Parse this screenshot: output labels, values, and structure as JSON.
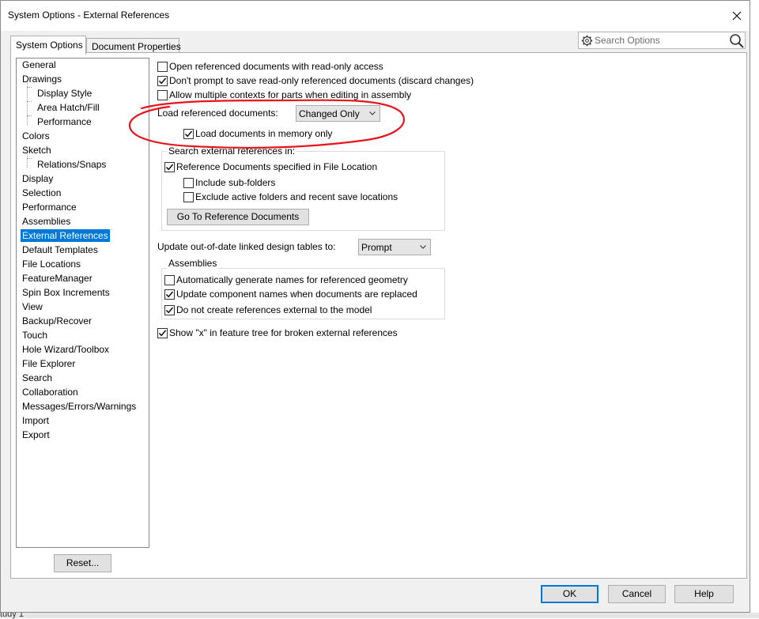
{
  "window": {
    "title": "System Options - External References"
  },
  "tabs": [
    {
      "label": "System Options"
    },
    {
      "label": "Document Properties"
    }
  ],
  "search": {
    "placeholder": "Search Options"
  },
  "tree": {
    "items": [
      {
        "label": "General"
      },
      {
        "label": "Drawings"
      },
      {
        "label": "Display Style"
      },
      {
        "label": "Area Hatch/Fill"
      },
      {
        "label": "Performance"
      },
      {
        "label": "Colors"
      },
      {
        "label": "Sketch"
      },
      {
        "label": "Relations/Snaps"
      },
      {
        "label": "Display"
      },
      {
        "label": "Selection"
      },
      {
        "label": "Performance"
      },
      {
        "label": "Assemblies"
      },
      {
        "label": "External References"
      },
      {
        "label": "Default Templates"
      },
      {
        "label": "File Locations"
      },
      {
        "label": "FeatureManager"
      },
      {
        "label": "Spin Box Increments"
      },
      {
        "label": "View"
      },
      {
        "label": "Backup/Recover"
      },
      {
        "label": "Touch"
      },
      {
        "label": "Hole Wizard/Toolbox"
      },
      {
        "label": "File Explorer"
      },
      {
        "label": "Search"
      },
      {
        "label": "Collaboration"
      },
      {
        "label": "Messages/Errors/Warnings"
      },
      {
        "label": "Import"
      },
      {
        "label": "Export"
      }
    ],
    "reset_label": "Reset..."
  },
  "options": {
    "open_read_only": {
      "label": "Open referenced documents with read-only access",
      "checked": false
    },
    "dont_prompt_save": {
      "label": "Don't prompt to save read-only referenced documents (discard changes)",
      "checked": true
    },
    "allow_multiple_contexts": {
      "label": "Allow multiple contexts for parts when editing in assembly",
      "checked": false
    },
    "load_referenced_label": "Load referenced documents:",
    "load_referenced_value": "Changed Only",
    "load_in_memory": {
      "label": "Load documents in memory only",
      "checked": true
    },
    "search_group_title": "Search external references in:",
    "reference_docs_file_location": {
      "label": "Reference Documents specified in File Location",
      "checked": true
    },
    "include_subfolders": {
      "label": "Include sub-folders",
      "checked": false
    },
    "exclude_active_folders": {
      "label": "Exclude active folders and recent save locations",
      "checked": false
    },
    "go_to_reference_docs": "Go To Reference Documents",
    "update_design_tables_label": "Update out-of-date linked design tables to:",
    "update_design_tables_value": "Prompt",
    "assemblies_group_title": "Assemblies",
    "auto_generate_names": {
      "label": "Automatically generate names for referenced geometry",
      "checked": false
    },
    "update_component_names": {
      "label": "Update component names when documents are replaced",
      "checked": true
    },
    "no_external_refs": {
      "label": "Do not create references external to the model",
      "checked": true
    },
    "show_x_broken": {
      "label": "Show \"x\" in feature tree for broken external references",
      "checked": true
    }
  },
  "footer": {
    "ok_label": "OK",
    "cancel_label": "Cancel",
    "help_label": "Help"
  },
  "colors": {
    "selection": "#0078d7",
    "annotation": "#e8141c"
  },
  "background_text": "tudy 1"
}
